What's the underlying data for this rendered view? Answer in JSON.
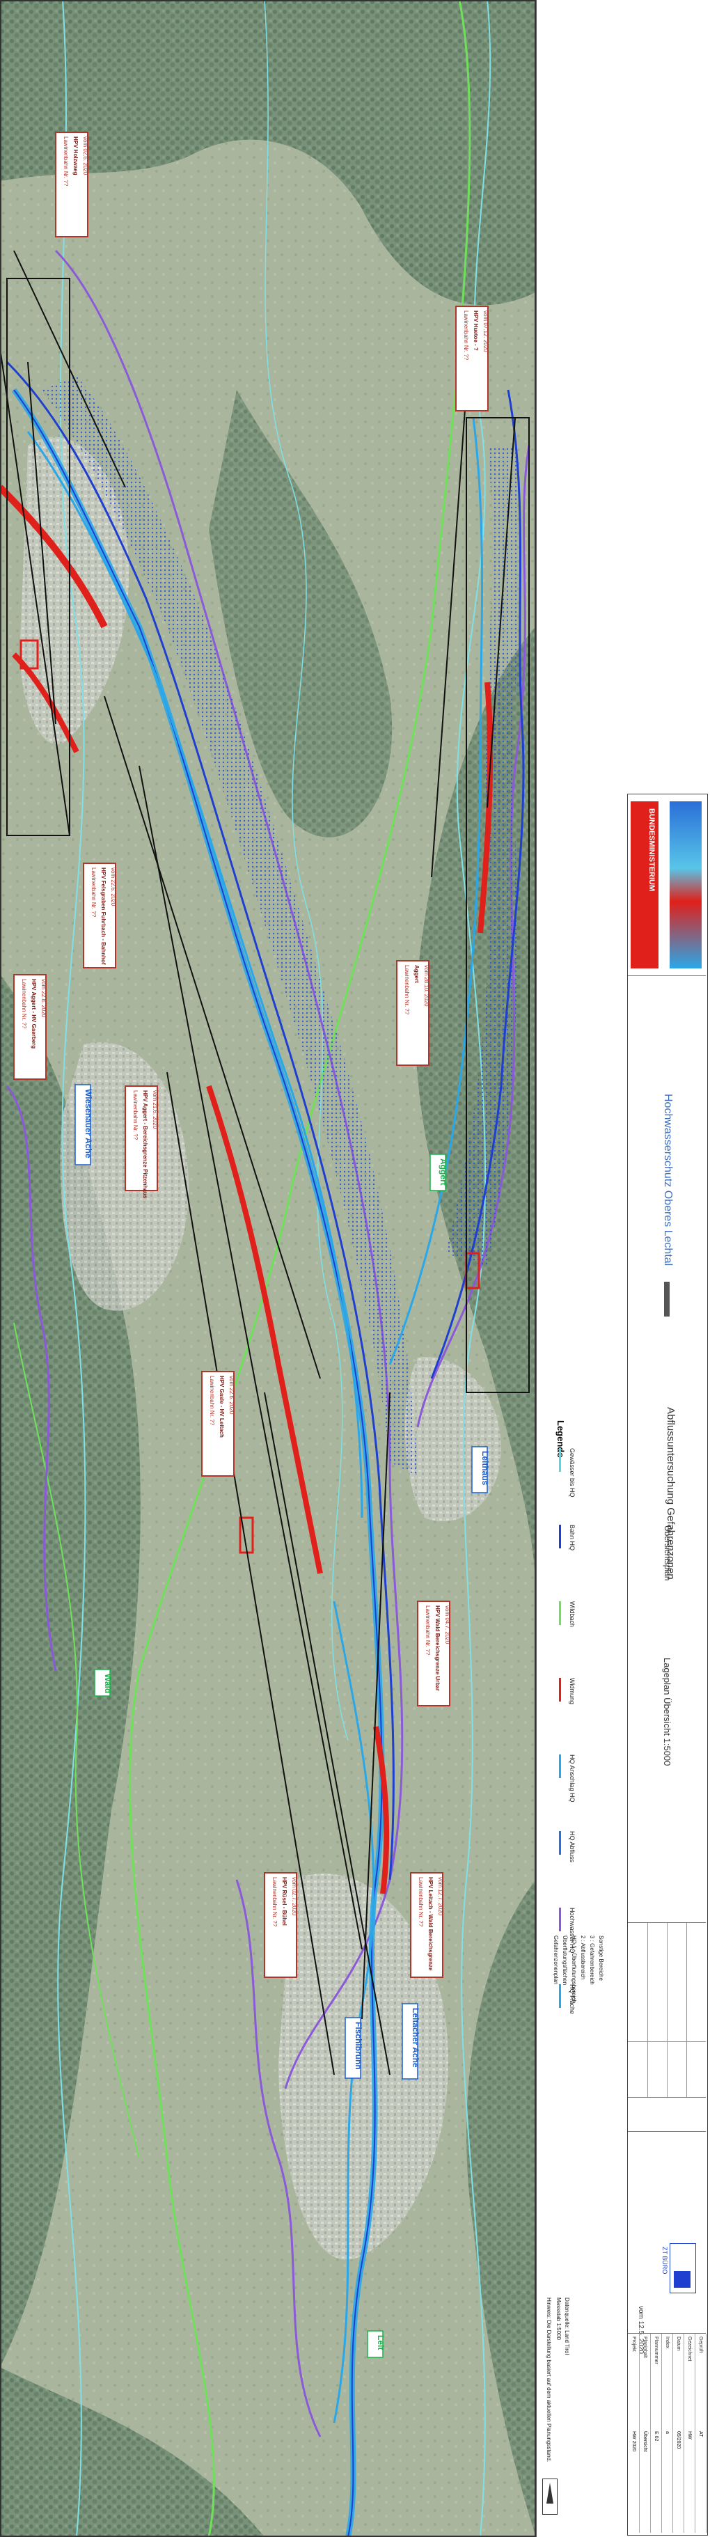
{
  "map": {
    "callouts": [
      {
        "title": "Lawinenbahn Nr. ??",
        "subtitle": "HPV Holzwaeg",
        "note": "vom 02.6. 2020",
        "color": "#b0362c"
      },
      {
        "title": "Lawinenbahn Nr. ??",
        "subtitle": "HPV Huetoe - ?",
        "note": "vom 07.12. 2020",
        "color": "#b0362c"
      },
      {
        "title": "Lawinenbahn Nr. ??",
        "subtitle": "HPV Felsgraben Fuhrbach - Bahnhof",
        "note": "vom 22.6. 2020",
        "color": "#b0362c"
      },
      {
        "title": "Lawinenbahn Nr. ??",
        "subtitle": "HPV Aggert - HV Gaerberg",
        "note": "vom 22.8. 2020",
        "color": "#b0362c"
      },
      {
        "title": "Lawinenbahn Nr. ??",
        "subtitle": "Aggert",
        "note": "vom 28.10. 2020",
        "color": "#b0362c"
      },
      {
        "title": "Lawinenbahn Nr. ??",
        "subtitle": "HPV Aggert - Bereichsgrenze Pitzenhaus",
        "note": "vom 21.6. 2020",
        "color": "#b0362c"
      },
      {
        "title": "Lawinenbahn Nr. ??",
        "subtitle": "HPV Gasle - HV Leitach",
        "note": "vom 22.6. 2020",
        "color": "#b0362c"
      },
      {
        "title": "Lawinenbahn Nr. ??",
        "subtitle": "HPV Wald Bereichsgrenze Urbar",
        "note": "vom 04.7. 2020",
        "color": "#b0362c"
      },
      {
        "title": "Lawinenbahn Nr. ??",
        "subtitle": "HPV Rüsel - Bühel",
        "note": "vom 02.7. 2020",
        "color": "#b0362c"
      },
      {
        "title": "Lawinenbahn Nr. ??",
        "subtitle": "HPV Leitach - Wald Bereichsgrenze",
        "note": "vom 12.7. 2020",
        "color": "#b0362c"
      }
    ],
    "places": [
      {
        "name": "Wiesenauer Ache",
        "color": "#1a5fd0"
      },
      {
        "name": "Aggert",
        "color": "#19b34a"
      },
      {
        "name": "Leithaus",
        "color": "#1a5fd0"
      },
      {
        "name": "Wald",
        "color": "#19b34a"
      },
      {
        "name": "Fischlbrunn",
        "color": "#1a5fd0"
      },
      {
        "name": "Leitacher Ache",
        "color": "#1a5fd0"
      },
      {
        "name": "Leit",
        "color": "#19b34a"
      }
    ]
  },
  "legend": {
    "title": "Legende",
    "items": [
      {
        "label": "Gewässer bis HQ",
        "color": "#5ad6e0",
        "style": "line"
      },
      {
        "label": "Bahn HQ",
        "color": "#1f3fd0",
        "style": "line"
      },
      {
        "label": "Wildbach",
        "color": "#6fe05a",
        "style": "line"
      },
      {
        "label": "Widmung",
        "color": "#e0201a",
        "style": "line"
      },
      {
        "label": "HQ Anschlag HQ",
        "color": "#2aa7e8",
        "style": "line"
      },
      {
        "label": "HQ Abfluss",
        "color": "#2b6fd8",
        "style": "line"
      },
      {
        "label": "Hochwasser HQ",
        "color": "#8a5ad8",
        "style": "line"
      },
      {
        "label": "HQ Fläche",
        "color": "#2aa7e8",
        "style": "line"
      }
    ],
    "notes": [
      "Gefahrenzonenplan",
      "Überflutungsflächen",
      "HQ 1 : Überflutungsbereich",
      "2 : Abflussbereich",
      "3 : Gefahrenbereich",
      "Sonstige Bereiche"
    ],
    "footnote": "Hinweis: Die Darstellung basiert auf dem aktuellen Planungsstand.",
    "scale": "Massstab 1:5000",
    "source": "Datenquelle: Land Tirol"
  },
  "sheet": {
    "project": "Hochwasserschutz Oberes Lechtal",
    "title": "Abflussuntersuchung Gefahrenzonen",
    "subtitle": "Übersichtsplan",
    "plan_no": "Lageplan Übersicht 1:5000",
    "logo_label": "BUNDESMINISTERIUM",
    "logo_sub": "LAND TIROL",
    "office": "ZT BÜRO",
    "date": "vom 12.5. 2020",
    "rows": [
      "Projekt",
      "Planinhalt",
      "Plannummer",
      "Index",
      "Datum",
      "Gezeichnet",
      "Geprüft"
    ],
    "values": [
      "HW 2020",
      "Übersicht",
      "E 02",
      "a",
      "05/2020",
      "HW",
      "AT"
    ]
  },
  "colors": {
    "red": "#e0201a",
    "darkred": "#b0362c",
    "blue": "#1f3fd0",
    "cyan": "#2aa7e8",
    "light_cyan": "#5ad6e0",
    "purple": "#8a5ad8",
    "green": "#6fe05a",
    "black": "#111111"
  }
}
